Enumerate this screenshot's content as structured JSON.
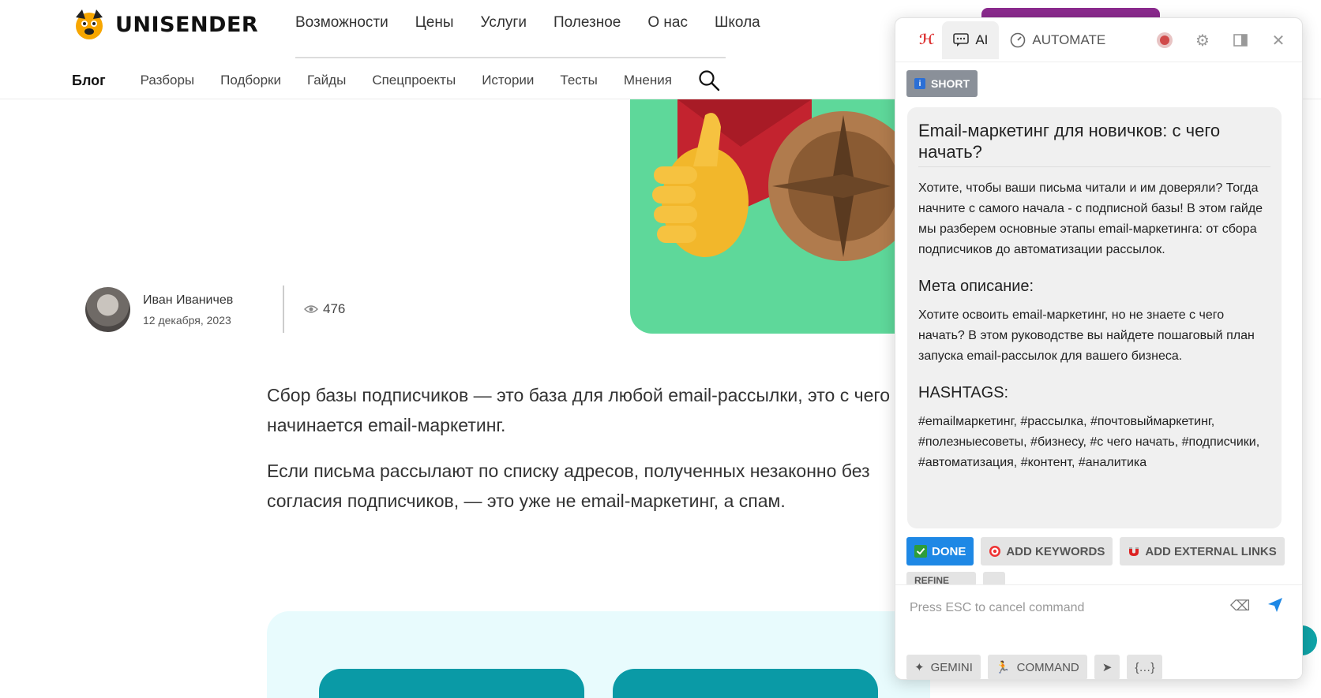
{
  "site": {
    "logo_text": "UNISENDER",
    "top_nav": [
      "Возможности",
      "Цены",
      "Услуги",
      "Полезное",
      "О нас",
      "Школа"
    ],
    "sub_nav_active": "Блог",
    "sub_nav": [
      "Разборы",
      "Подборки",
      "Гайды",
      "Спецпроекты",
      "Истории",
      "Тесты",
      "Мнения"
    ]
  },
  "article": {
    "author_name": "Иван Иваничев",
    "date": "12 декабря, 2023",
    "views": "476",
    "paragraph1": "Сбор базы подписчиков — это база для любой email-рассылки, это с чего начинается email-маркетинг.",
    "paragraph2": "Если письма рассылают по списку адресов, полученных незаконно без согласия подписчиков, — это уже не email-маркетинг, а спам."
  },
  "panel": {
    "tabs": {
      "ai": "AI",
      "automate": "AUTOMATE"
    },
    "short_label": "SHORT",
    "title": "Email-маркетинг для новичков: с чего начать?",
    "intro": "Хотите, чтобы ваши письма читали и им доверяли? Тогда начните с самого начала - с подписной базы! В этом гайде мы разберем основные этапы email-маркетинга: от сбора подписчиков до автоматизации рассылок.",
    "meta_heading": "Мета описание:",
    "meta_text": "Хотите освоить email-маркетинг, но не знаете с чего начать? В этом руководстве вы найдете пошаговый план запуска email-рассылок для вашего бизнеса.",
    "hashtags_heading": "HASHTAGS:",
    "hashtags": "#emailмаркетинг, #рассылка, #почтовыймаркетинг, #полезныесоветы, #бизнесу, #с чего начать, #подписчики, #автоматизация, #контент, #аналитика",
    "actions": {
      "done": "DONE",
      "add_keywords": "ADD KEYWORDS",
      "add_links": "ADD EXTERNAL LINKS",
      "refine": "REFINE"
    },
    "input_placeholder": "Press ESC to cancel command",
    "bottom": {
      "gemini": "GEMINI",
      "command": "COMMAND"
    }
  },
  "colors": {
    "accent_purple": "#8b2a8e",
    "hero_green": "#5ed89a",
    "done_blue": "#1e88e5",
    "teal": "#0a9aa6"
  }
}
